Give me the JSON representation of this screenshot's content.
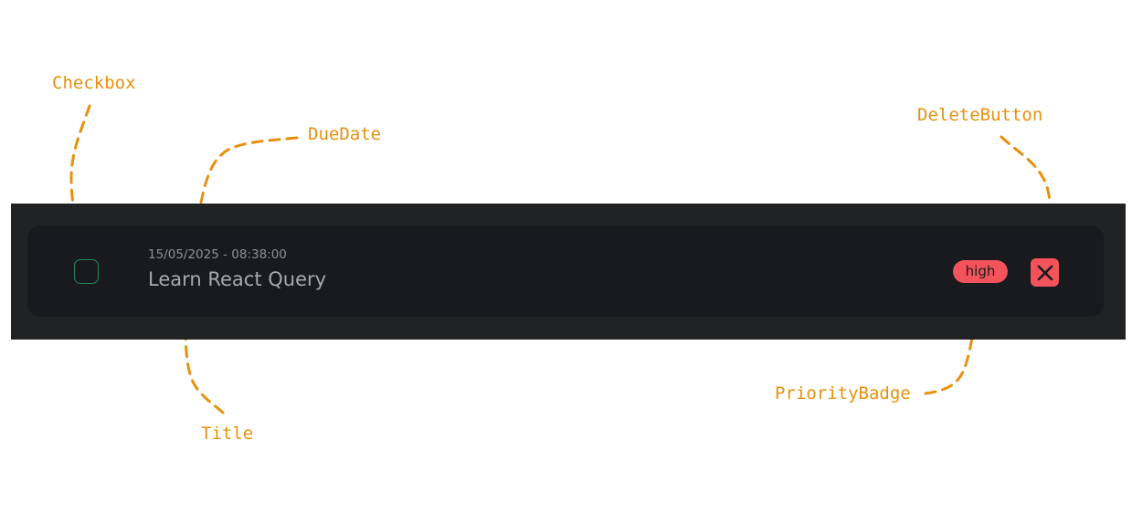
{
  "annotations": {
    "checkbox": "Checkbox",
    "due_date": "DueDate",
    "delete_button": "DeleteButton",
    "title": "Title",
    "priority_badge": "PriorityBadge"
  },
  "todo_item": {
    "due_date": "15/05/2025 - 08:38:00",
    "title": "Learn React Query",
    "priority": "high",
    "completed": false
  },
  "colors": {
    "annotation": "#e8900e",
    "strip_background": "#212223",
    "card_background": "#191a1e",
    "checkbox_border": "#1f8a5b",
    "priority_high": "#f4535c",
    "delete_button": "#f4535c",
    "title_text": "#a6a9ae",
    "date_text": "#8e9095"
  },
  "icons": {
    "delete": "close-icon"
  }
}
